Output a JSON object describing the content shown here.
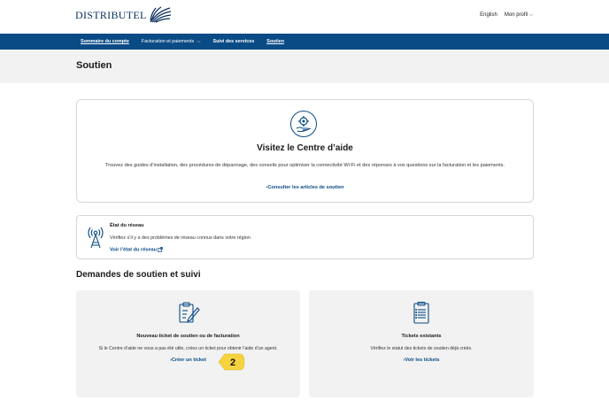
{
  "brand": {
    "name": "DISTRIBUTEL",
    "color": "#0a4b86"
  },
  "top_links": {
    "language": "English",
    "profile": "Mon profil"
  },
  "nav": {
    "items": [
      {
        "label": "Sommaire du compte"
      },
      {
        "label": "Facturation et paiements"
      },
      {
        "label": "Suivi des services"
      },
      {
        "label": "Soutien"
      }
    ]
  },
  "page": {
    "title": "Soutien"
  },
  "help_center": {
    "title": "Visitez le Centre d’aide",
    "description": "Trouvez des guides d’installation, des procédures de dépannage, des conseils pour optimiser la connectivité Wi-Fi et des réponses à vos questions sur la facturation et les paiements.",
    "link": "Consulter les articles de soutien",
    "icon": "gear-hand-icon"
  },
  "network": {
    "title": "État du réseau",
    "description": "Vérifiez s’il y a des problèmes de réseau connus dans votre région",
    "link": "Voir l’état du réseau",
    "icon": "antenna-icon"
  },
  "requests": {
    "section_title": "Demandes de soutien et suivi",
    "new_ticket": {
      "title": "Nouveau ticket de soutien ou de facturation",
      "description": "Si le Centre d’aide ne vous a pas été utile, créez un ticket pour obtenir l’aide d’un agent.",
      "link": "Créer un ticket",
      "icon": "edit-document-icon"
    },
    "existing": {
      "title": "Tickets existants",
      "description": "Vérifiez le statut des tickets de soutien déjà créés.",
      "link": "Voir les tickets",
      "icon": "clipboard-list-icon"
    }
  },
  "annotation": {
    "step": "2",
    "color": "#f5d33f"
  }
}
